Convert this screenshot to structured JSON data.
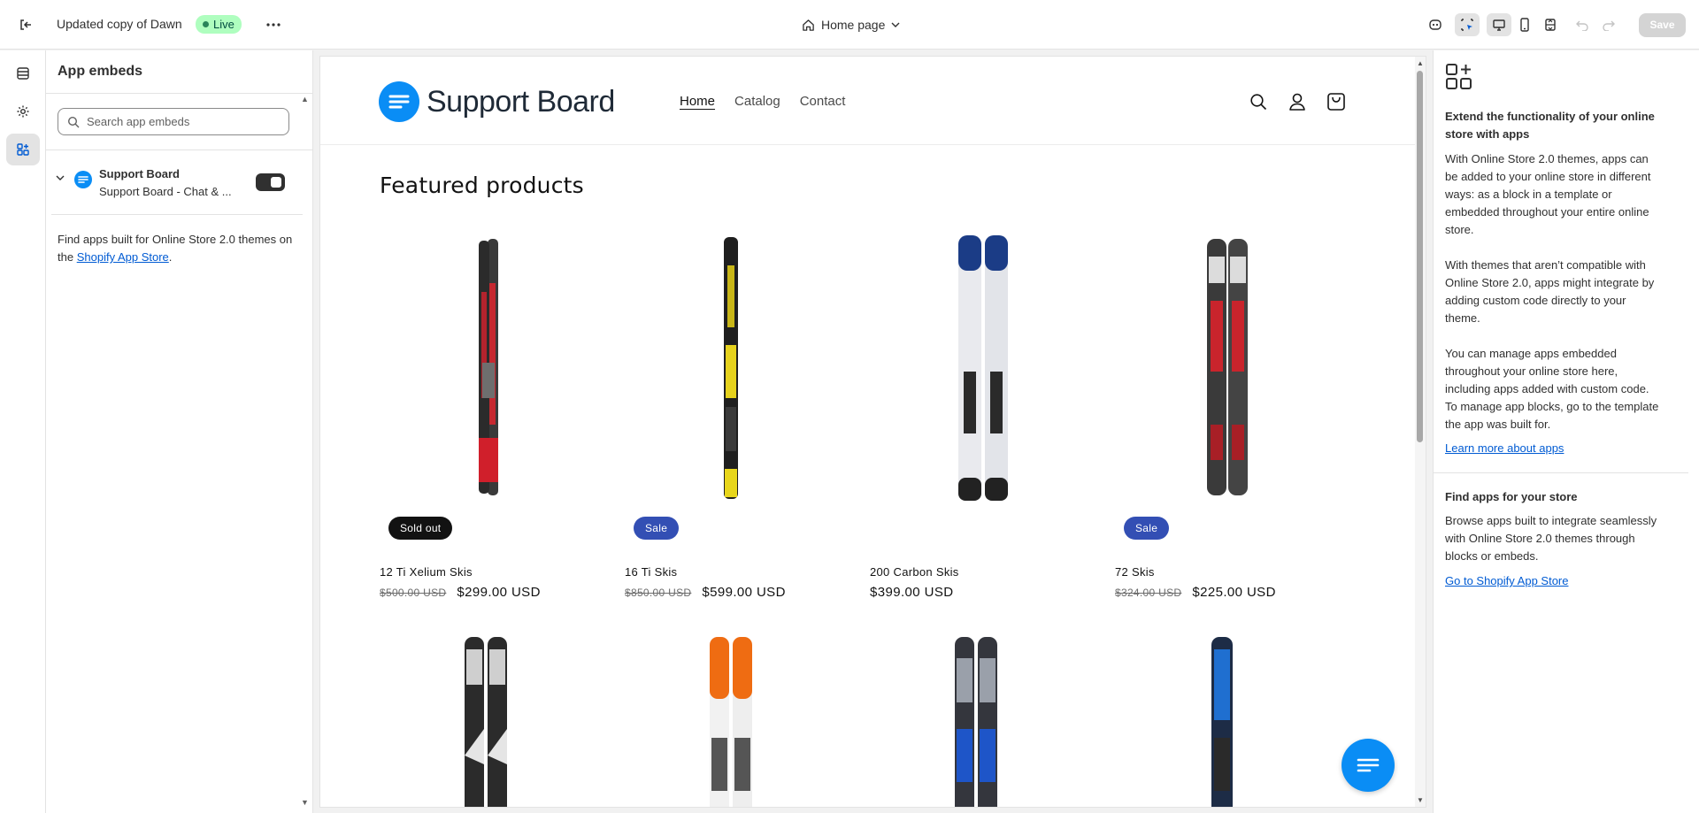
{
  "topbar": {
    "theme_name": "Updated copy of Dawn",
    "status_badge": "Live",
    "page_selector": "Home page",
    "save_label": "Save"
  },
  "sidebar": {
    "title": "App embeds",
    "search_placeholder": "Search app embeds",
    "embed": {
      "name": "Support Board",
      "subtitle": "Support Board - Chat & ...",
      "enabled": true
    },
    "help_text": "Find apps built for Online Store 2.0 themes on the",
    "help_link": "Shopify App Store",
    "help_end": "."
  },
  "store": {
    "logo_text": "Support Board",
    "nav": [
      "Home",
      "Catalog",
      "Contact"
    ],
    "section_title": "Featured products",
    "products": [
      {
        "name": "12 Ti Xelium Skis",
        "old_price": "$500.00 USD",
        "price": "$299.00 USD",
        "badge": "Sold out"
      },
      {
        "name": "16 Ti Skis",
        "old_price": "$850.00 USD",
        "price": "$599.00 USD",
        "badge": "Sale"
      },
      {
        "name": "200 Carbon Skis",
        "old_price": "",
        "price": "$399.00 USD",
        "badge": ""
      },
      {
        "name": "72 Skis",
        "old_price": "$324.00 USD",
        "price": "$225.00 USD",
        "badge": "Sale"
      }
    ]
  },
  "right_panel": {
    "heading": "Extend the functionality of your online store with apps",
    "p1": "With Online Store 2.0 themes, apps can be added to your online store in different ways: as a block in a template or embedded throughout your entire online store.",
    "p2": "With themes that aren’t compatible with Online Store 2.0, apps might integrate by adding custom code directly to your theme.",
    "p3": "You can manage apps embedded throughout your online store here, including apps added with custom code. To manage app blocks, go to the template the app was built for.",
    "link1": "Learn more about apps",
    "heading2": "Find apps for your store",
    "p4": "Browse apps built to integrate seamlessly with Online Store 2.0 themes through blocks or embeds.",
    "link2": "Go to Shopify App Store"
  },
  "colors": {
    "accent_blue": "#0a8df5",
    "live_green": "#affebf",
    "sale_badge": "#334fb4",
    "link": "#005bd3"
  }
}
